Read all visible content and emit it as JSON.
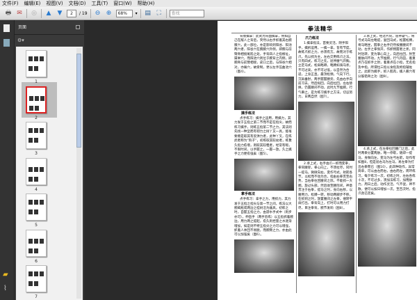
{
  "menu": [
    "文件(F)",
    "编辑(E)",
    "视图(V)",
    "文档(D)",
    "工具(T)",
    "窗口(W)",
    "帮助(H)"
  ],
  "toolbar": {
    "page_current": "2",
    "page_total": "/ 19",
    "zoom": "68%",
    "search_placeholder": "查找"
  },
  "panel": {
    "title": "页面"
  },
  "thumbnails": [
    {
      "label": "1"
    },
    {
      "label": "2",
      "selected": true
    },
    {
      "label": "3"
    },
    {
      "label": "4"
    },
    {
      "label": "5"
    },
    {
      "label": "6"
    },
    {
      "label": "7"
    }
  ],
  "page": {
    "title": "拳法精华",
    "col1": {
      "p1": "背後擒拿：此式为背面擒拿，例如自己在敌人之背后，突然以右手抓着其右腕腋穴，此一部位，亦是影响到阳谷、阳池两穴者，阳谷穴在腕腋穴外侧，即腕与前臂骨相接尾陷之处，手背四人之指根址，属举穴，而阳池穴则位于腕背之内侧，即腕骨与前臂相接，皮口之后，与阳谷穴相对，亦痛穴，故受制，更以左手压曲池穴（图4）。",
      "h2": "擒手练法",
      "p2": "点手练习：擒手之运用，用擒力，其力发于五指之第二节而不是在指尖，故而练习擒手，则练五指第二节之力，其法则先找一种坚而有韧力之树丫又一具，能毫要擦是取其有反弹力者，此种丫叉，在练武者称为“狗子”，初练取其较幼者，练惫久指力愈增，则取其较粗者，经常有暇，不限时间，以手握之，一握一放，久之擒手之力便愈强矣（图5）。",
      "h3": "拿手练法",
      "p3": "点手练习：拿手之力，用抓力，其力发于五指之指尖与第一节之间，练法以大腕竭瓶或两边之桂树沿为器具，初练之时，自握五指之力，由游水手式中（则步亦可），伸直手（两手皆练）以五指抓着腕边，用力两之提起，愈久则捏量之水逐渐增加，如是则不特五指尖之力可以增强，抓着人体回不易脱，而腕臂之力，亦由此可以加强矣（图6）。"
    },
    "col2": {
      "h1": "爪力练法",
      "p1": "1.擒拿指法，首要灵活，阴手阳手，擒拆运用，一擒一拿，皆有节度，故练爪抓之力，亦须有方，故而对于练爪，先以抓为主，左右交用练爪之法，只有四式，练习之先，屈伸腰气开胸，立定马式，松肩略蹲，略膊如骑马状，不可过高，亦不可过低，以自然为合适，上身正直，最顶松颈，气向下行，沉肩垂肘，两手握握腰旁，先由右手向前习去，然后拟回，向后拉回，左右替换，仍置腰间不动，此时九节挫腕，行气串之，是为练习擒手之方法，切忌努力，日两自然（图7）。",
      "p2": "2.承上式，右手由爪一抓而变拳，拳同腰际，拳心向上，不须拉尽，同时一提马，微微向右，变作弓式，射箭各节，以松而不动为合，指由右拳贯至右势，当右拳往回腰间之际，不能抓一大圈，旋过头部，然后收至腰际间，神意贯注于右拳，提马之时，身向右移，以腰用力，松膊一转，移动两脚步不移，在抓到之时，放置腰间之左拳，捆转平肩打出，拳背向上，打时可以用力打尽，目注拳背，腕节发响（图8）。"
    },
    "col3": {
      "p1": "3.承上式，经过片刻，屈神凝气，将弓式马向左略提，复回马式，松握松膊，将马略坐，握拳之右手仍然按腰腰间不动，左手之拳张开，作抓物握者之状，同时括转，变为掌心向上，向后拉回，肘至腰胁间不动，九节挫腕，行气丹田，着重点乃在抓手之肘，着重点在小指，无名指及中指，所谓拉三指以食指及拇指辅佐之，此即为擒手，抓人肌肉，擒人腋穴有分筋错骨之功（图9）。",
      "p2": "4.承上式，在左拳拉回腰门之后，此时两拳分置两胁，略一停歇，随即一提马，身微向左，变马为左弓右箭，动作有如图8，但是屈右马为左马，易左拳为打出右拳而已（图10），此四种动作，异常简单，可以由左而右，由右而左，周环练习，每夕练习一次，初练之时，左右各练十次，不可过多，须加法练习，加用胁力，周日之后，动作灵活，气不促，神不散，便可以按日增加一次，至百次时，指爪劲已足矣。"
    },
    "figure_labels": [
      "图4",
      "图5",
      "图6",
      "图7",
      "图8",
      "图9",
      "图10"
    ]
  }
}
